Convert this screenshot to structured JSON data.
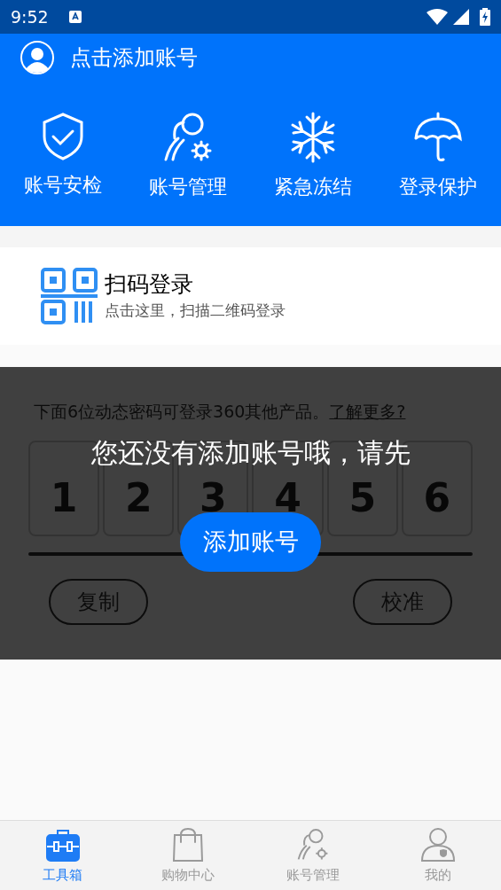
{
  "status_bar": {
    "time": "9:52"
  },
  "header": {
    "account_label": "点击添加账号"
  },
  "tools": [
    {
      "kind": "shield",
      "label": "账号安检"
    },
    {
      "kind": "users",
      "label": "账号管理"
    },
    {
      "kind": "snowflake",
      "label": "紧急冻结"
    },
    {
      "kind": "umbrella",
      "label": "登录保护"
    }
  ],
  "scan_login": {
    "title": "扫码登录",
    "subtitle": "点击这里，扫描二维码登录"
  },
  "otp": {
    "intro": "下面6位动态密码可登录360其他产品。",
    "link": "了解更多?",
    "digits": [
      "1",
      "2",
      "3",
      "4",
      "5",
      "6"
    ],
    "buttons": [
      "复制",
      "校准"
    ]
  },
  "overlay": {
    "message": "您还没有添加账号哦，请先",
    "button": "添加账号"
  },
  "tabs": [
    {
      "kind": "toolbox",
      "label": "工具箱",
      "selected": true
    },
    {
      "kind": "bag",
      "label": "购物中心",
      "selected": false
    },
    {
      "kind": "users",
      "label": "账号管理",
      "selected": false
    },
    {
      "kind": "person",
      "label": "我的",
      "selected": false
    }
  ]
}
